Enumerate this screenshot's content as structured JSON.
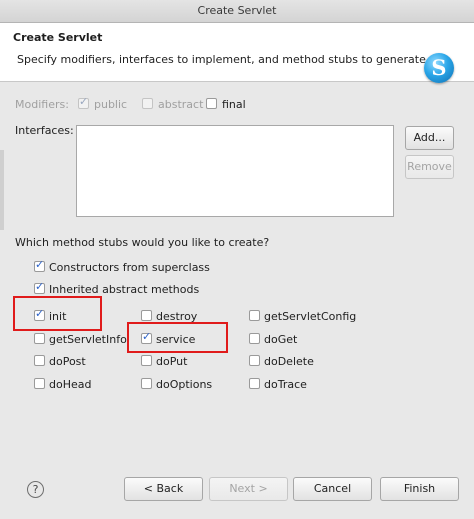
{
  "window": {
    "title": "Create Servlet"
  },
  "header": {
    "title": "Create Servlet",
    "description": "Specify modifiers, interfaces to implement, and method stubs to generate."
  },
  "modifiers": {
    "label": "Modifiers:",
    "public": {
      "label": "public",
      "checked": true,
      "enabled": false
    },
    "abstract": {
      "label": "abstract",
      "checked": false,
      "enabled": false
    },
    "final": {
      "label": "final",
      "checked": false,
      "enabled": true
    }
  },
  "interfaces": {
    "label": "Interfaces:",
    "add_label": "Add...",
    "remove_label": "Remove"
  },
  "stubs": {
    "question": "Which method stubs would you like to create?",
    "constructors": {
      "label": "Constructors from superclass",
      "checked": true
    },
    "inherited": {
      "label": "Inherited abstract methods",
      "checked": true
    },
    "methods": [
      {
        "label": "init",
        "checked": true
      },
      {
        "label": "destroy",
        "checked": false
      },
      {
        "label": "getServletConfig",
        "checked": false
      },
      {
        "label": "getServletInfo",
        "checked": false
      },
      {
        "label": "service",
        "checked": true
      },
      {
        "label": "doGet",
        "checked": false
      },
      {
        "label": "doPost",
        "checked": false
      },
      {
        "label": "doPut",
        "checked": false
      },
      {
        "label": "doDelete",
        "checked": false
      },
      {
        "label": "doHead",
        "checked": false
      },
      {
        "label": "doOptions",
        "checked": false
      },
      {
        "label": "doTrace",
        "checked": false
      }
    ]
  },
  "footer": {
    "help_glyph": "?",
    "back_label": "< Back",
    "next_label": "Next >",
    "cancel_label": "Cancel",
    "finish_label": "Finish"
  },
  "colors": {
    "highlight": "#e01b1b",
    "check": "#2d63c9"
  }
}
